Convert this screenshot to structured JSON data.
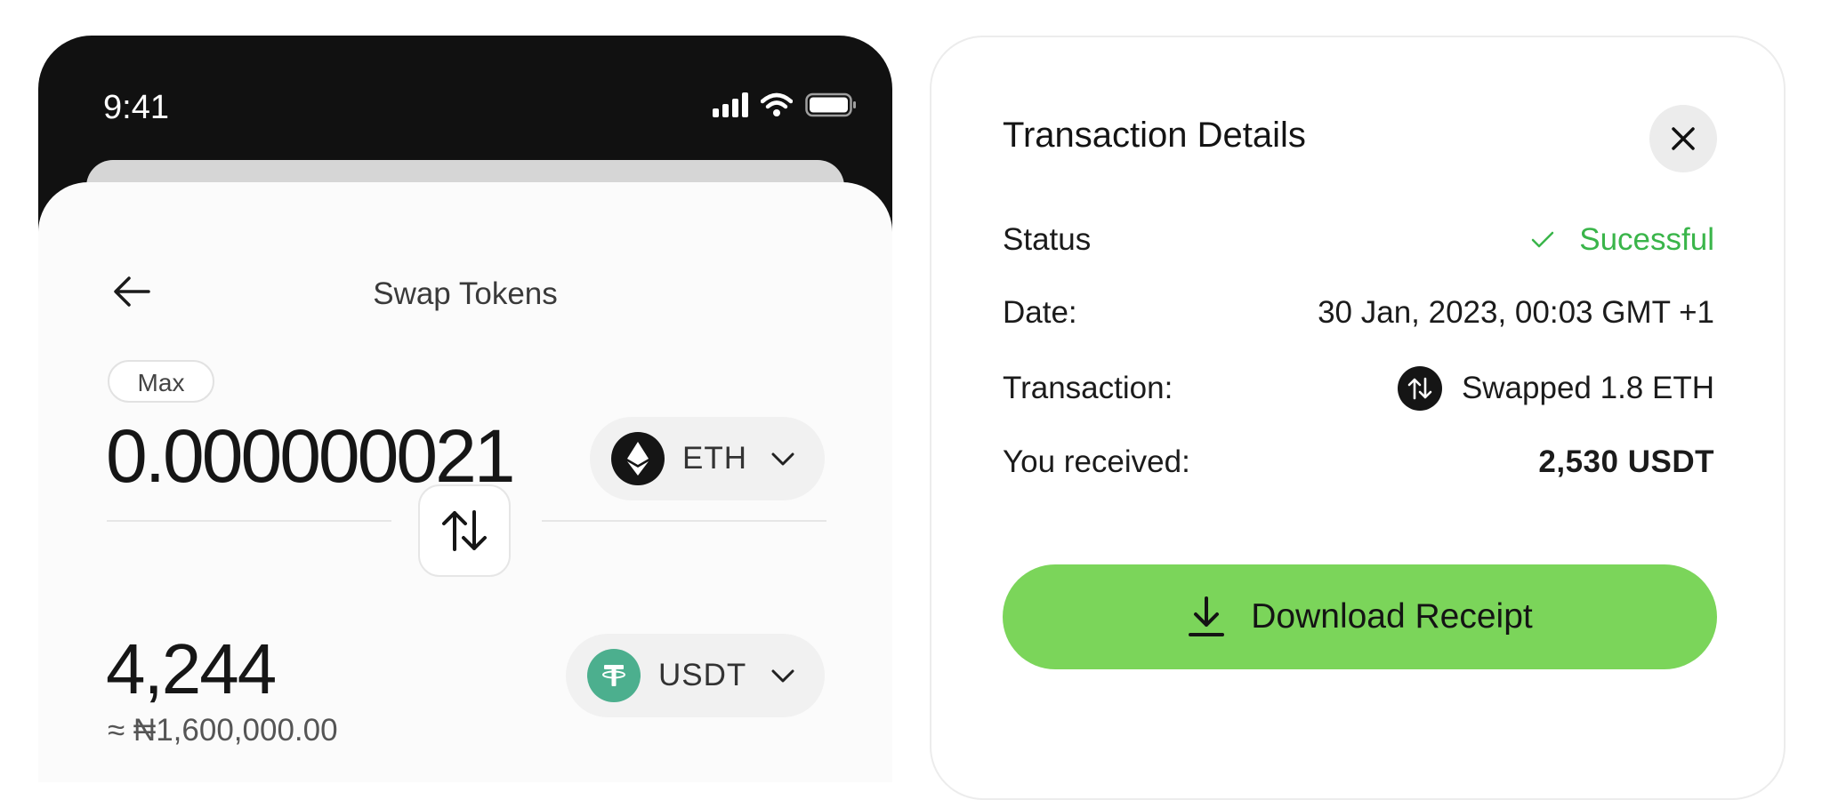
{
  "phone": {
    "status_bar": {
      "time": "9:41"
    },
    "header": {
      "title": "Swap Tokens"
    },
    "from": {
      "max_label": "Max",
      "amount": "0.000000021",
      "token": "ETH"
    },
    "to": {
      "amount": "4,244",
      "fiat_equivalent": "≈ ₦1,600,000.00",
      "token": "USDT"
    }
  },
  "details": {
    "title": "Transaction Details",
    "rows": {
      "status": {
        "label": "Status",
        "value": "Sucessful",
        "color": "#3ab54a"
      },
      "date": {
        "label": "Date:",
        "value": "30 Jan, 2023, 00:03 GMT +1"
      },
      "transaction": {
        "label": "Transaction:",
        "value": "Swapped 1.8 ETH",
        "icon": "swap-arrows-icon"
      },
      "received": {
        "label": "You received:",
        "value": "2,530 USDT"
      }
    },
    "download_button": {
      "label": "Download Receipt",
      "icon": "download-icon",
      "color": "#7bd55a"
    }
  },
  "colors": {
    "eth_icon_bg": "#151515",
    "usdt_icon_bg": "#4caf8e",
    "phone_frame": "#111111"
  }
}
